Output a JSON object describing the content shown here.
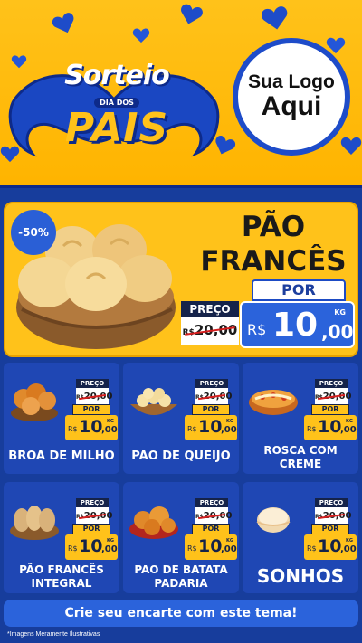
{
  "brand": {
    "line1": "Sorteio",
    "line2": "DIA DOS",
    "line3": "PAIS"
  },
  "logo": {
    "line1": "Sua Logo",
    "line2": "Aqui"
  },
  "featured": {
    "badge": "-50%",
    "title_line1": "PÃO",
    "title_line2": "FRANCÊS",
    "por_label": "POR",
    "preco_label": "PREÇO",
    "old_currency": "R$",
    "old_price": "20,00",
    "currency": "R$",
    "price_int": "10",
    "price_dec": ",00",
    "unit": "KG"
  },
  "products": [
    {
      "name": "BROA DE MILHO",
      "preco_label": "PREÇO",
      "old_currency": "R$",
      "old_price": "20,00",
      "por_label": "POR",
      "currency": "R$",
      "price_int": "10",
      "price_dec": ",00",
      "unit": "KG"
    },
    {
      "name": "PAO DE QUEIJO",
      "preco_label": "PREÇO",
      "old_currency": "R$",
      "old_price": "20,00",
      "por_label": "POR",
      "currency": "R$",
      "price_int": "10",
      "price_dec": ",00",
      "unit": "KG"
    },
    {
      "name": "ROSCA COM CREME",
      "preco_label": "PREÇO",
      "old_currency": "R$",
      "old_price": "20,00",
      "por_label": "POR",
      "currency": "R$",
      "price_int": "10",
      "price_dec": ",00",
      "unit": "KG"
    },
    {
      "name": "PÃO FRANCÊS INTEGRAL",
      "preco_label": "PREÇO",
      "old_currency": "R$",
      "old_price": "20,00",
      "por_label": "POR",
      "currency": "R$",
      "price_int": "10",
      "price_dec": ",00",
      "unit": "KG"
    },
    {
      "name": "PAO DE BATATA PADARIA",
      "preco_label": "PREÇO",
      "old_currency": "R$",
      "old_price": "20,00",
      "por_label": "POR",
      "currency": "R$",
      "price_int": "10",
      "price_dec": ",00",
      "unit": "KG"
    },
    {
      "name": "SONHOS",
      "preco_label": "PREÇO",
      "old_currency": "R$",
      "old_price": "20,00",
      "por_label": "POR",
      "currency": "R$",
      "price_int": "10",
      "price_dec": ",00",
      "unit": "KG"
    }
  ],
  "cta": {
    "label": "Crie seu encarte com este tema!"
  },
  "footnote": "*Imagens Meramente Ilustrativas",
  "colors": {
    "yellow": "#ffc21a",
    "blue": "#173d9c",
    "accent_blue": "#2b63db",
    "navy": "#15234a",
    "strike_red": "#d51f1f"
  },
  "icons": [
    "heart-icon",
    "mustache-icon",
    "bread-basket-image"
  ]
}
